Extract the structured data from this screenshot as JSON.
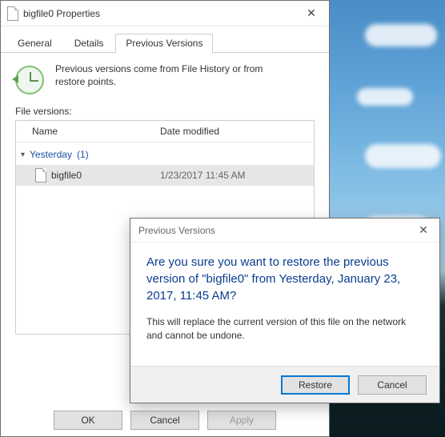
{
  "propsWindow": {
    "title": "bigfile0 Properties",
    "tabs": [
      "General",
      "Details",
      "Previous Versions"
    ],
    "activeTabIndex": 2,
    "info": "Previous versions come from File History or from restore points.",
    "sectionLabel": "File versions:",
    "columns": {
      "name": "Name",
      "date": "Date modified"
    },
    "group": {
      "label": "Yesterday",
      "count": "(1)"
    },
    "file": {
      "name": "bigfile0",
      "date": "1/23/2017 11:45 AM"
    },
    "buttons": {
      "ok": "OK",
      "cancel": "Cancel",
      "apply": "Apply"
    }
  },
  "confirm": {
    "title": "Previous Versions",
    "main": "Are you sure you want to restore the previous version of \"bigfile0\" from Yesterday, January 23, 2017, 11:45 AM?",
    "sub": "This will replace the current version of this file on the network and cannot be undone.",
    "restore": "Restore",
    "cancel": "Cancel"
  }
}
